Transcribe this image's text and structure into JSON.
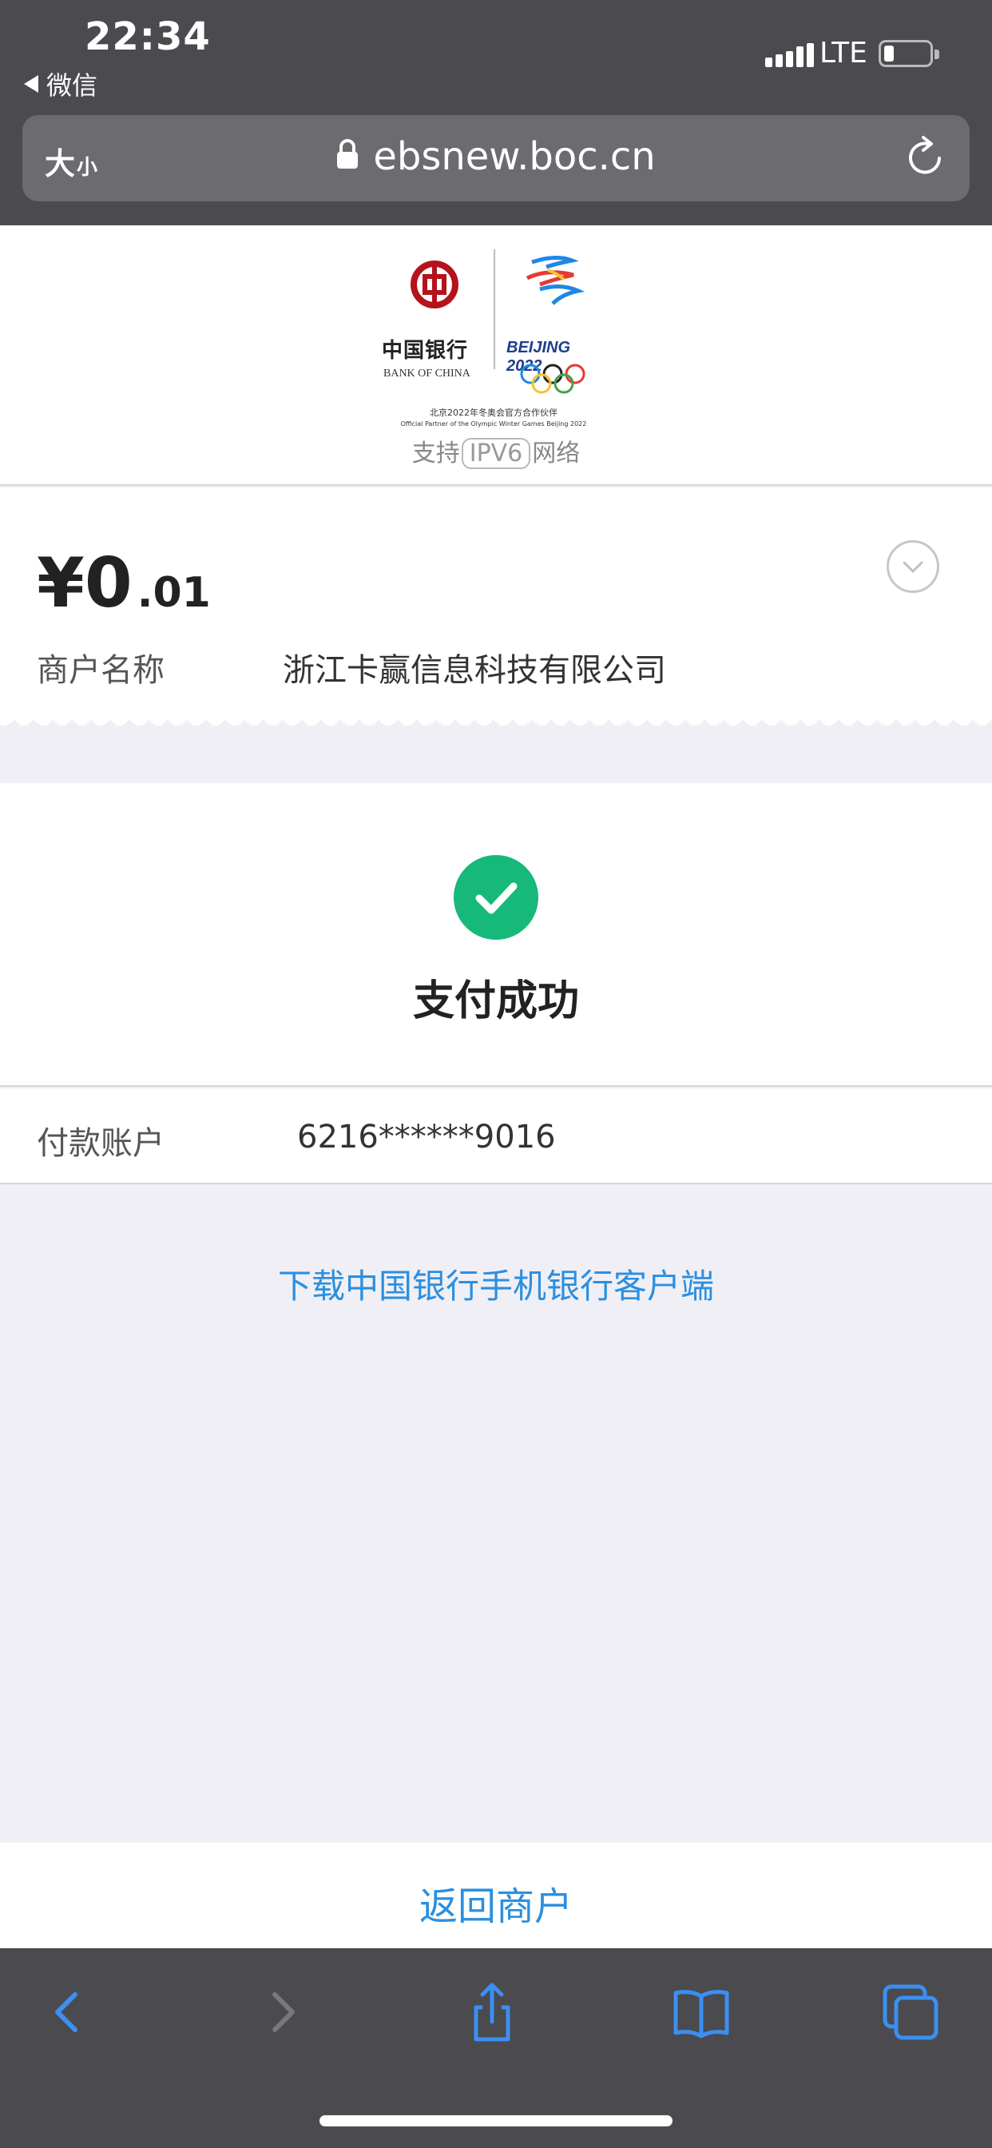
{
  "status_bar": {
    "time": "22:34",
    "back_app": "微信",
    "network": "LTE"
  },
  "browser": {
    "text_size": "大",
    "text_size_small": "小",
    "url": "ebsnew.boc.cn"
  },
  "header": {
    "bank_name_cn": "中国银行",
    "bank_name_en": "BANK OF CHINA",
    "olympic_text": "BEIJING 2022",
    "partner_cn": "北京2022年冬奥会官方合作伙伴",
    "partner_en": "Official Partner of the Olympic Winter Games Beijing 2022",
    "network_prefix": "支持",
    "network_badge": "IPV6",
    "network_suffix": "网络"
  },
  "payment": {
    "amount_int": "¥0",
    "amount_dec": ".01",
    "merchant_label": "商户名称",
    "merchant_name": "浙江卡赢信息科技有限公司"
  },
  "result": {
    "status": "支付成功",
    "account_label": "付款账户",
    "account_value": "6216******9016",
    "download_link": "下载中国银行手机银行客户端",
    "return_label": "返回商户"
  },
  "colors": {
    "link": "#2b8fe0",
    "success": "#16b97a",
    "toolbar": "#4a4a4f",
    "toolbar_icon": "#3b8ff0"
  }
}
